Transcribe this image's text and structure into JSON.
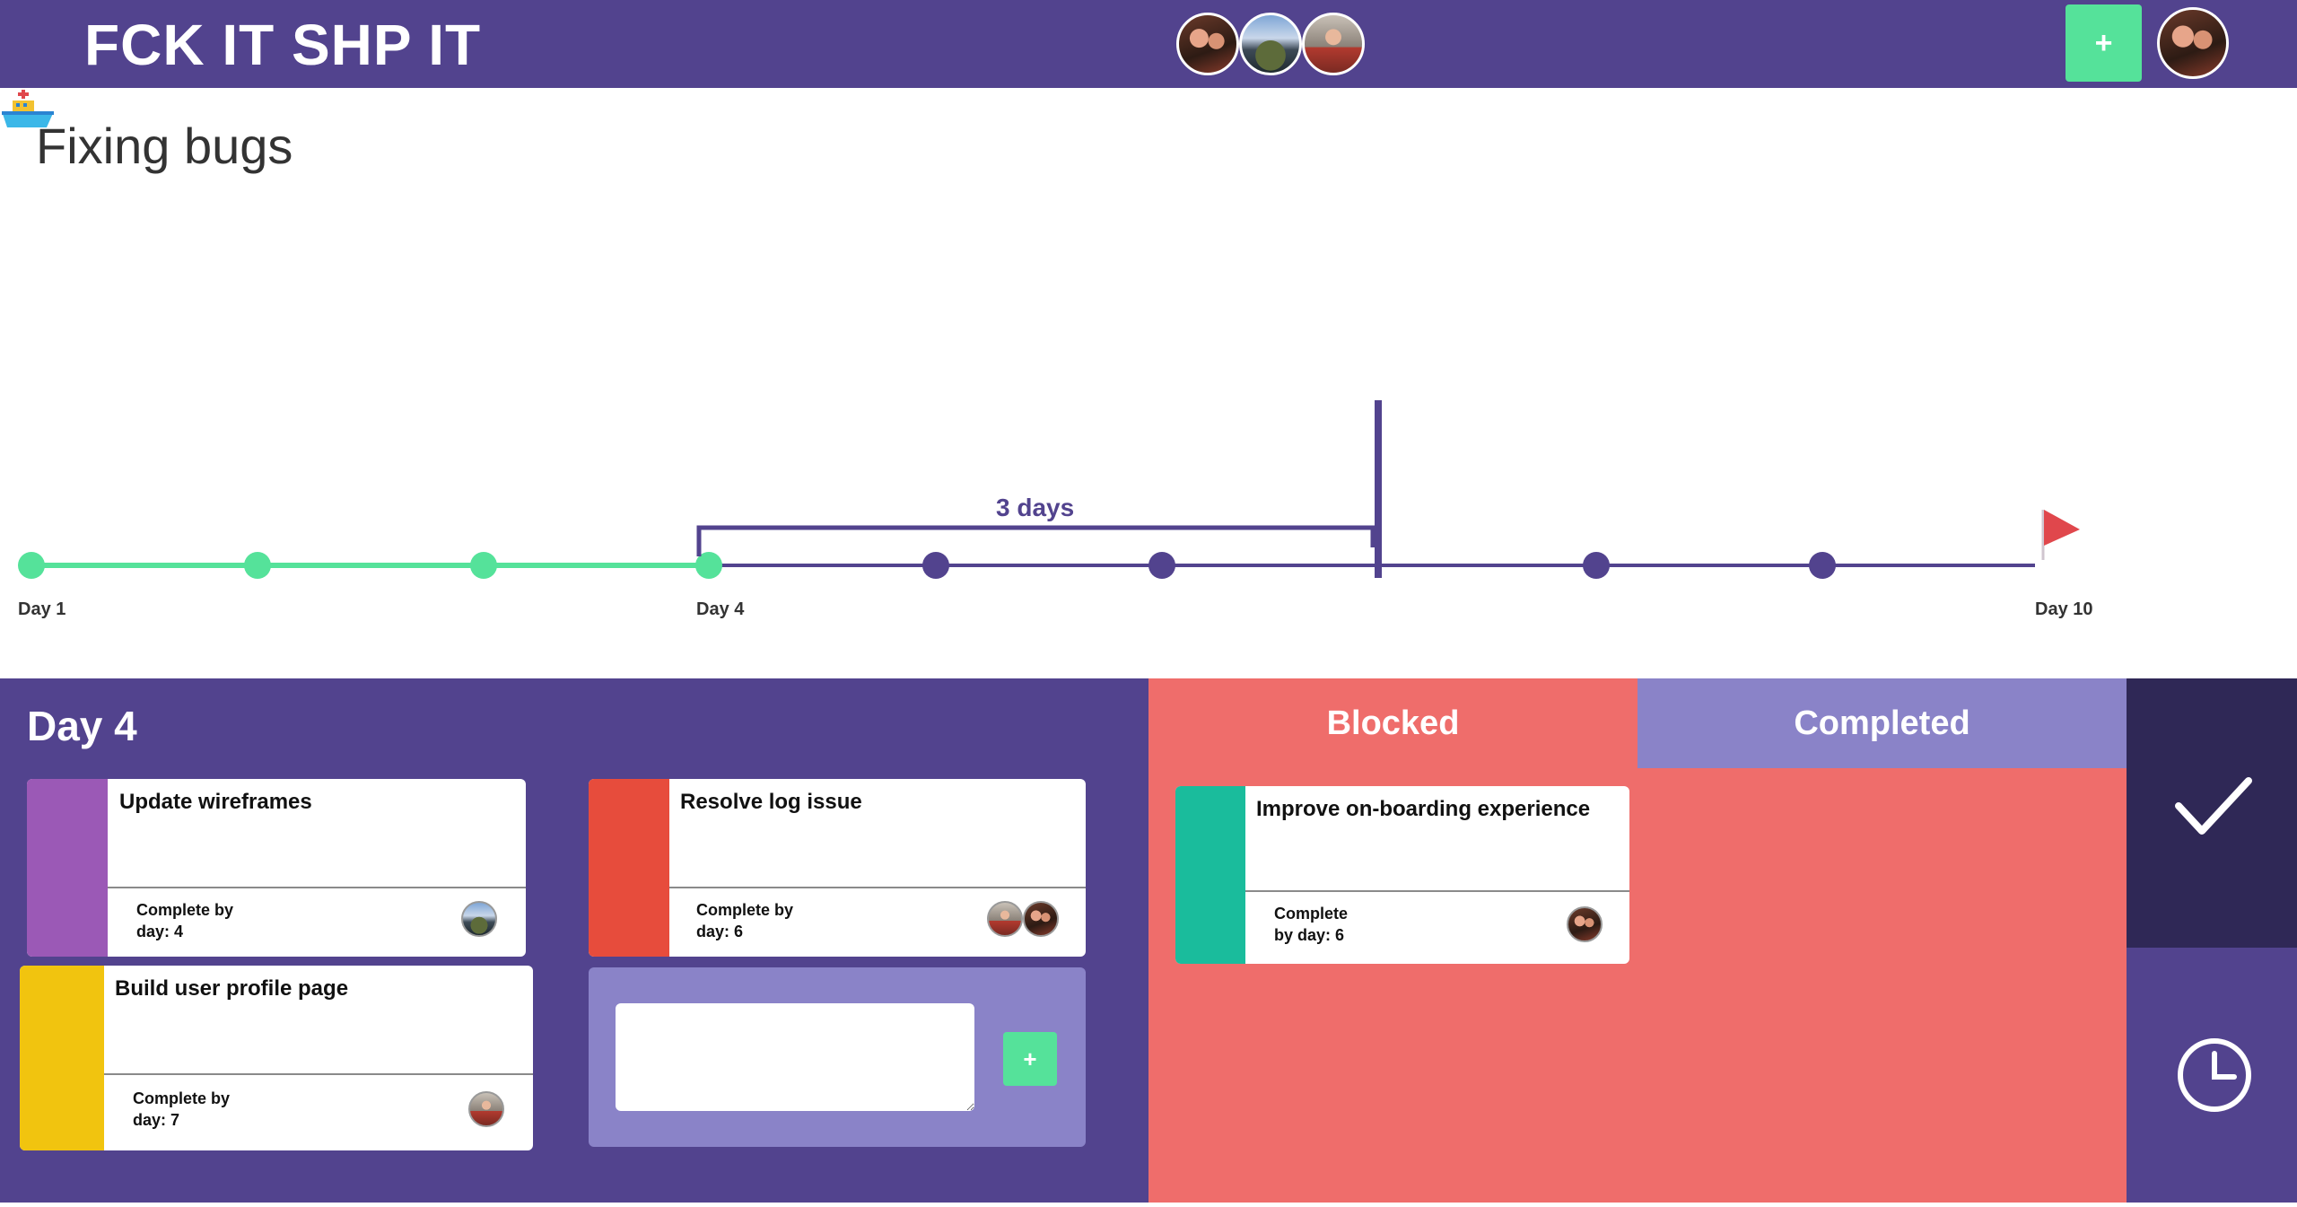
{
  "header": {
    "brand": "FCK IT SHP IT",
    "add_label": "+",
    "members": [
      "member-1-avatar",
      "member-2-avatar",
      "member-3-avatar"
    ]
  },
  "project": {
    "title": "Fixing bugs"
  },
  "timeline": {
    "start_label": "Day 1",
    "current_label": "Day 4",
    "end_label": "Day 10",
    "span_label": "3 days",
    "total_days": 10,
    "current_day": 4,
    "colors": {
      "done": "#55e29a",
      "upcoming": "#52438e",
      "flag": "#e0474c"
    }
  },
  "day_panel": {
    "title": "Day 4",
    "cards": [
      {
        "title": "Update wireframes",
        "due_line1": "Complete by",
        "due_line2": "day: 4",
        "color": "#9b59b6"
      },
      {
        "title": "Resolve log issue",
        "due_line1": "Complete by",
        "due_line2": "day: 6",
        "color": "#e74c3c"
      },
      {
        "title": "Build user profile page",
        "due_line1": "Complete by",
        "due_line2": "day: 7",
        "color": "#f1c40f"
      }
    ],
    "new_task": {
      "placeholder": "",
      "add_label": "+"
    }
  },
  "status_tabs": {
    "blocked": "Blocked",
    "completed": "Completed"
  },
  "blocked_cards": [
    {
      "title": "Improve on-boarding experience",
      "due_line1": "Complete",
      "due_line2": "by day: 6",
      "color": "#1abc9c"
    }
  ],
  "side_actions": {
    "check": "check-icon",
    "history": "clock-icon"
  }
}
